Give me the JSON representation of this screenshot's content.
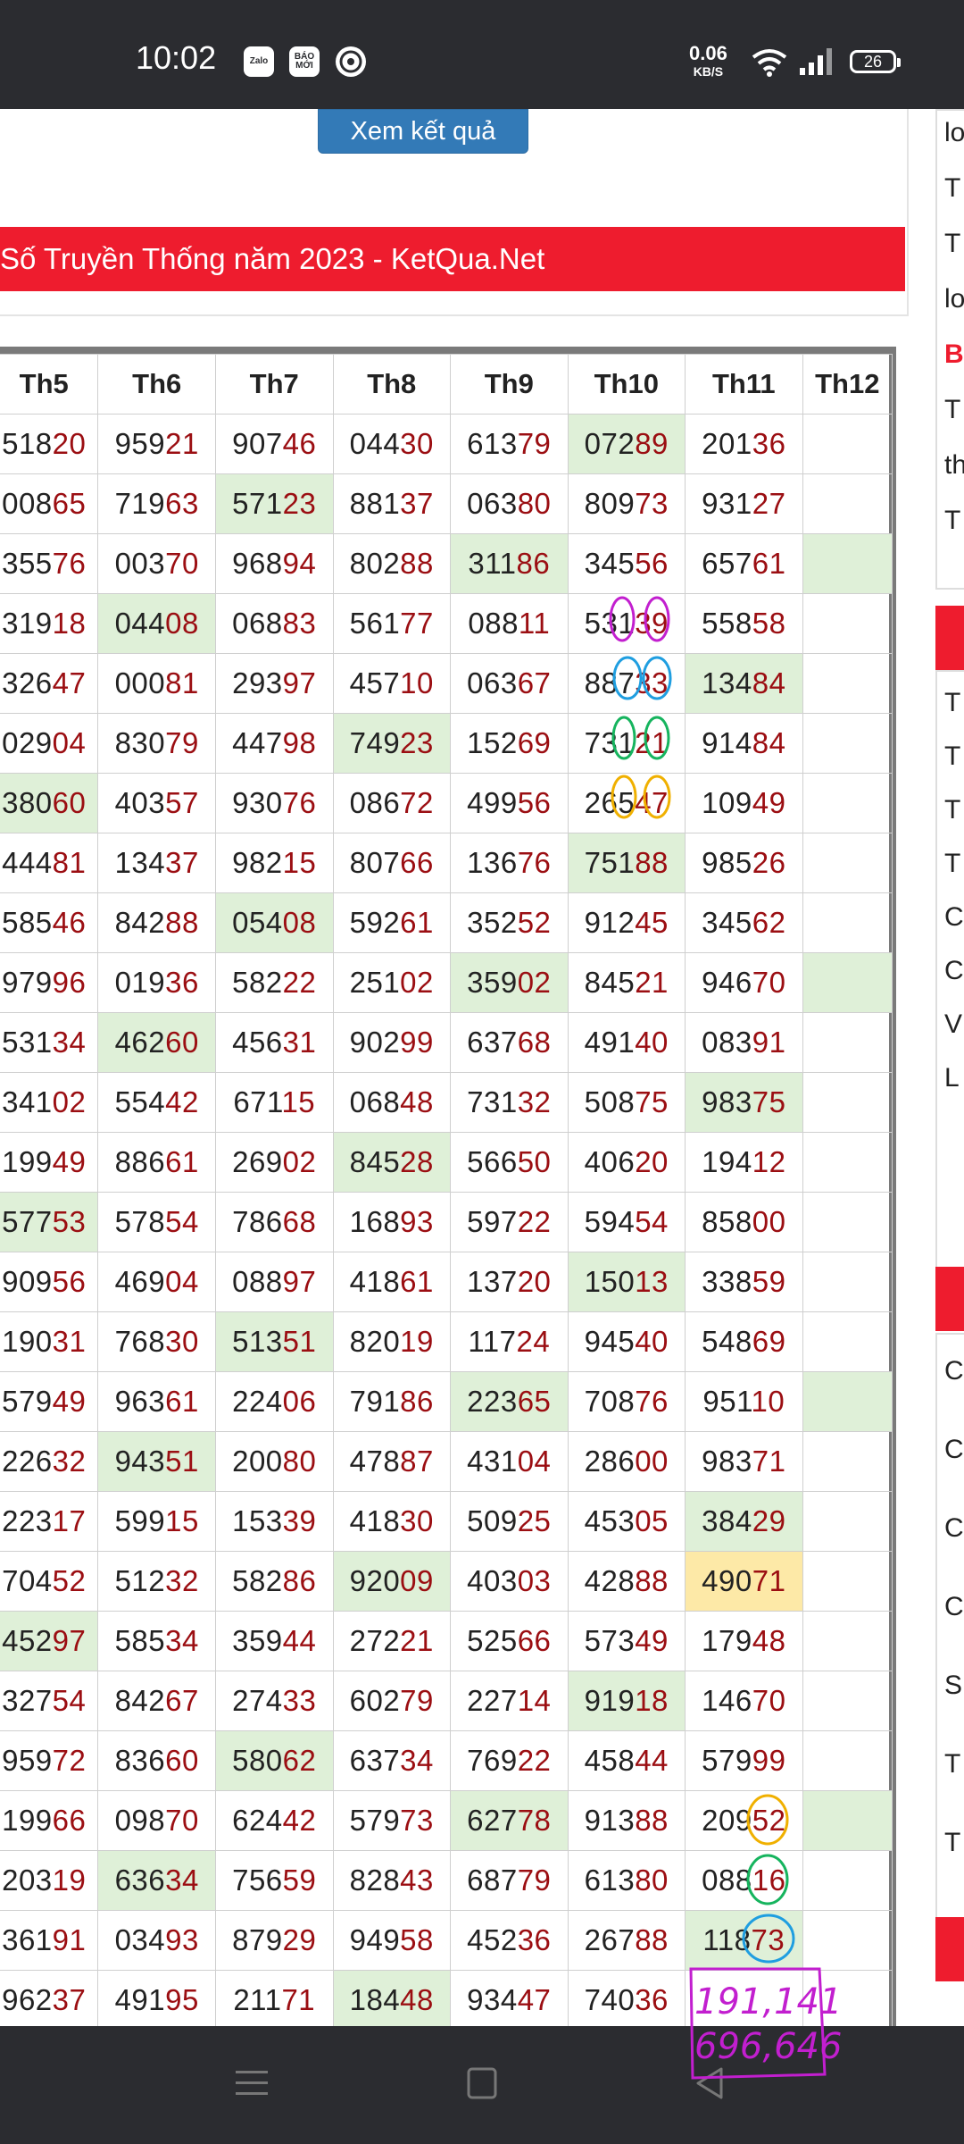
{
  "status_bar": {
    "time": "10:02",
    "app_icons": [
      "Zalo",
      "BÁO MỚI"
    ],
    "app_icon_names": [
      "zalo-icon",
      "baomoi-icon",
      "chrome-icon"
    ],
    "net_speed": "0.06",
    "net_unit": "KB/S",
    "battery": "26"
  },
  "form": {
    "view_button": "Xem kết quả"
  },
  "section_title": "Số Truyền Thống năm 2023 - KetQua.Net",
  "table": {
    "headers": [
      "Th5",
      "Th6",
      "Th7",
      "Th8",
      "Th9",
      "Th10",
      "Th11",
      "Th12"
    ],
    "rows": [
      [
        "51820",
        "95921",
        "90746",
        "04430",
        "61379",
        "07289",
        "20136",
        ""
      ],
      [
        "00865",
        "71963",
        "57123",
        "88137",
        "06380",
        "80973",
        "93127",
        ""
      ],
      [
        "35576",
        "00370",
        "96894",
        "80288",
        "31186",
        "34556",
        "65761",
        ""
      ],
      [
        "31918",
        "04408",
        "06883",
        "56177",
        "08811",
        "53139",
        "55858",
        ""
      ],
      [
        "32647",
        "00081",
        "29397",
        "45710",
        "06367",
        "88733",
        "13484",
        ""
      ],
      [
        "02904",
        "83079",
        "44798",
        "74923",
        "15269",
        "73121",
        "91484",
        ""
      ],
      [
        "38060",
        "40357",
        "93076",
        "08672",
        "49956",
        "26547",
        "10949",
        ""
      ],
      [
        "44481",
        "13437",
        "98215",
        "80766",
        "13676",
        "75188",
        "98526",
        ""
      ],
      [
        "58546",
        "84288",
        "05408",
        "59261",
        "35252",
        "91245",
        "34562",
        ""
      ],
      [
        "97996",
        "01936",
        "58222",
        "25102",
        "35902",
        "84521",
        "94670",
        ""
      ],
      [
        "53134",
        "46260",
        "45631",
        "90299",
        "63768",
        "49140",
        "08391",
        ""
      ],
      [
        "34102",
        "55442",
        "67115",
        "06848",
        "73132",
        "50875",
        "98375",
        ""
      ],
      [
        "19949",
        "88661",
        "26902",
        "84528",
        "56650",
        "40620",
        "19412",
        ""
      ],
      [
        "57753",
        "57854",
        "78668",
        "16893",
        "59722",
        "59454",
        "85800",
        ""
      ],
      [
        "90956",
        "46904",
        "08897",
        "41861",
        "13720",
        "15013",
        "33859",
        ""
      ],
      [
        "19031",
        "76830",
        "51351",
        "82019",
        "11724",
        "94540",
        "54869",
        ""
      ],
      [
        "57949",
        "96361",
        "22406",
        "79186",
        "22365",
        "70876",
        "95110",
        ""
      ],
      [
        "22632",
        "94351",
        "20080",
        "47887",
        "43104",
        "28600",
        "98371",
        ""
      ],
      [
        "22317",
        "59915",
        "15339",
        "41830",
        "50925",
        "45305",
        "38429",
        ""
      ],
      [
        "70452",
        "51232",
        "58286",
        "92009",
        "40303",
        "42888",
        "49071",
        ""
      ],
      [
        "45297",
        "58534",
        "35944",
        "27221",
        "52566",
        "57349",
        "17948",
        ""
      ],
      [
        "32754",
        "84267",
        "27433",
        "60279",
        "22714",
        "91918",
        "14670",
        ""
      ],
      [
        "95972",
        "83660",
        "58062",
        "63734",
        "76922",
        "45844",
        "57999",
        ""
      ],
      [
        "19966",
        "09870",
        "62442",
        "57973",
        "62778",
        "91388",
        "20952",
        ""
      ],
      [
        "20319",
        "63634",
        "75659",
        "82843",
        "68779",
        "61380",
        "08816",
        ""
      ],
      [
        "36191",
        "03493",
        "87929",
        "94958",
        "45236",
        "26788",
        "11873",
        ""
      ],
      [
        "96237",
        "49195",
        "21171",
        "18448",
        "93447",
        "74036",
        "",
        ""
      ]
    ],
    "highlights": [
      [
        0,
        5
      ],
      [
        1,
        2
      ],
      [
        2,
        4
      ],
      [
        2,
        7
      ],
      [
        3,
        1
      ],
      [
        4,
        6
      ],
      [
        5,
        3
      ],
      [
        6,
        0
      ],
      [
        7,
        5
      ],
      [
        8,
        2
      ],
      [
        9,
        4
      ],
      [
        9,
        7
      ],
      [
        10,
        1
      ],
      [
        11,
        6
      ],
      [
        12,
        3
      ],
      [
        13,
        0
      ],
      [
        14,
        5
      ],
      [
        15,
        2
      ],
      [
        16,
        4
      ],
      [
        16,
        7
      ],
      [
        17,
        1
      ],
      [
        18,
        6
      ],
      [
        19,
        3
      ],
      [
        20,
        0
      ],
      [
        21,
        5
      ],
      [
        22,
        2
      ],
      [
        23,
        4
      ],
      [
        23,
        7
      ],
      [
        24,
        1
      ],
      [
        25,
        6
      ],
      [
        26,
        3
      ]
    ],
    "yellow_highlights": [
      [
        19,
        6
      ]
    ]
  },
  "sidebar": {
    "rows_top": [
      "lo",
      "T",
      "T",
      "lo",
      "B",
      "T",
      "th",
      "T"
    ],
    "rows_mid": [
      "T",
      "T",
      "T",
      "T",
      "C",
      "C",
      "V",
      "L"
    ],
    "rows_bot": [
      "C",
      "C",
      "C",
      "C",
      "S",
      "T",
      "T"
    ]
  },
  "handwriting": {
    "line1": "191,141",
    "line2": "696,646"
  },
  "navbar_icons": [
    "menu-icon",
    "home-icon",
    "back-icon"
  ]
}
